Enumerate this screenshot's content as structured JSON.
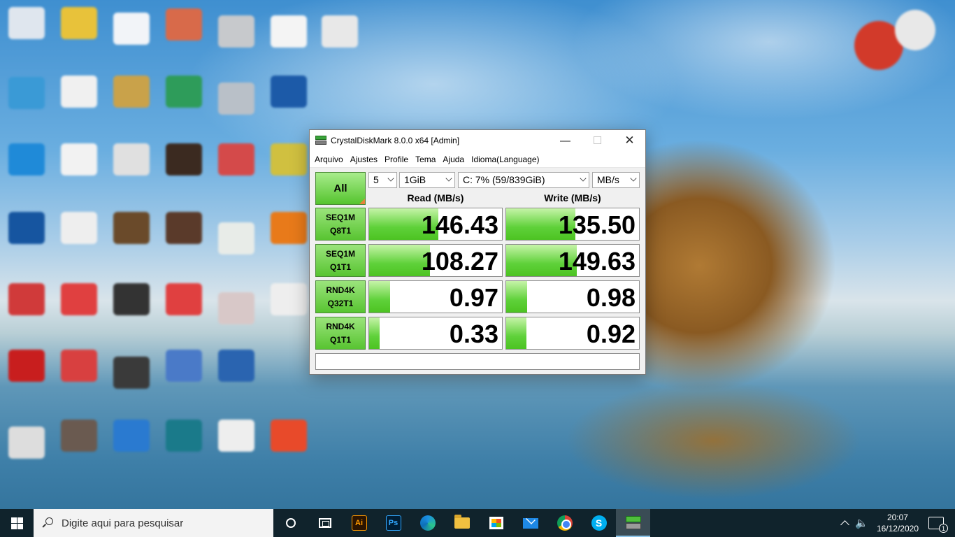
{
  "window": {
    "title": "CrystalDiskMark 8.0.0 x64 [Admin]",
    "menu": [
      "Arquivo",
      "Ajustes",
      "Profile",
      "Tema",
      "Ajuda",
      "Idioma(Language)"
    ]
  },
  "controls": {
    "all_label": "All",
    "count": "5",
    "size": "1GiB",
    "drive": "C: 7% (59/839GiB)",
    "unit": "MB/s"
  },
  "headers": {
    "read": "Read (MB/s)",
    "write": "Write (MB/s)"
  },
  "rows": [
    {
      "line1": "SEQ1M",
      "line2": "Q8T1",
      "read": "146.43",
      "write": "135.50",
      "read_fill": 0.52,
      "write_fill": 0.52
    },
    {
      "line1": "SEQ1M",
      "line2": "Q1T1",
      "read": "108.27",
      "write": "149.63",
      "read_fill": 0.46,
      "write_fill": 0.53
    },
    {
      "line1": "RND4K",
      "line2": "Q32T1",
      "read": "0.97",
      "write": "0.98",
      "read_fill": 0.16,
      "write_fill": 0.16
    },
    {
      "line1": "RND4K",
      "line2": "Q1T1",
      "read": "0.33",
      "write": "0.92",
      "read_fill": 0.08,
      "write_fill": 0.15
    }
  ],
  "comment": "",
  "taskbar": {
    "search_placeholder": "Digite aqui para pesquisar",
    "ai_label": "Ai",
    "ps_label": "Ps",
    "skype_label": "S",
    "time": "20:07",
    "date": "16/12/2020",
    "notification_count": "1"
  }
}
